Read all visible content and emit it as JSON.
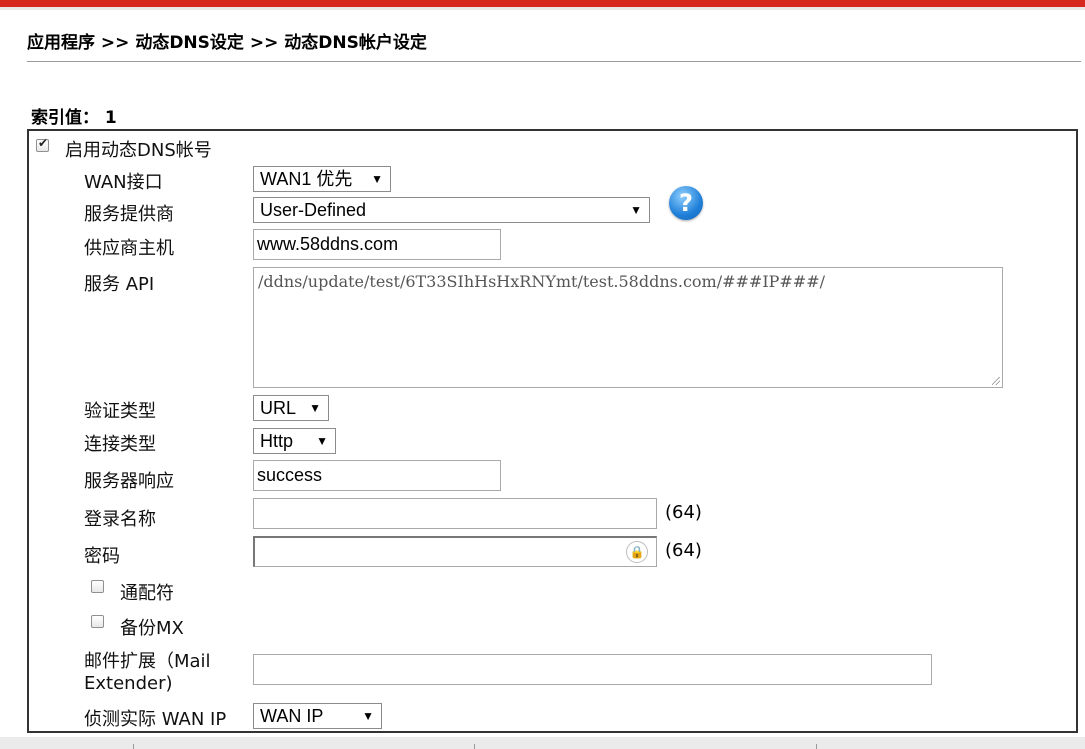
{
  "breadcrumb": "应用程序 >> 动态DNS设定 >> 动态DNS帐户设定",
  "index_label": "索引值： 1",
  "enable": {
    "label": "启用动态DNS帐号",
    "checked": true
  },
  "form": {
    "wan_interface": {
      "label": "WAN接口",
      "value": "WAN1 优先"
    },
    "provider": {
      "label": "服务提供商",
      "value": "User-Defined"
    },
    "provider_host": {
      "label": "供应商主机",
      "value": "www.58ddns.com"
    },
    "service_api": {
      "label": "服务 API",
      "value": "/ddns/update/test/6T33SIhHsHxRNYmt/test.58ddns.com/###IP###/"
    },
    "auth_type": {
      "label": "验证类型",
      "value": "URL"
    },
    "connection_type": {
      "label": "连接类型",
      "value": "Http"
    },
    "server_response": {
      "label": "服务器响应",
      "value": "success"
    },
    "login_name": {
      "label": "登录名称",
      "value": "",
      "limit": "(64)"
    },
    "password": {
      "label": "密码",
      "value": "",
      "limit": "(64)"
    },
    "wildcard": {
      "label": "通配符",
      "checked": false
    },
    "backup_mx": {
      "label": "备份MX",
      "checked": false
    },
    "mail_extender": {
      "label_line1": "邮件扩展（Mail",
      "label_line2": "Extender)",
      "value": ""
    },
    "detect_wan_ip": {
      "label": "侦测实际 WAN IP",
      "value": "WAN IP"
    }
  },
  "colors": {
    "accent_bar": "#d7281f",
    "help_icon": "#1f7fd8"
  },
  "icons": {
    "help": "help-question-icon",
    "lock": "password-lock-icon",
    "dropdown": "dropdown-arrow-icon"
  }
}
